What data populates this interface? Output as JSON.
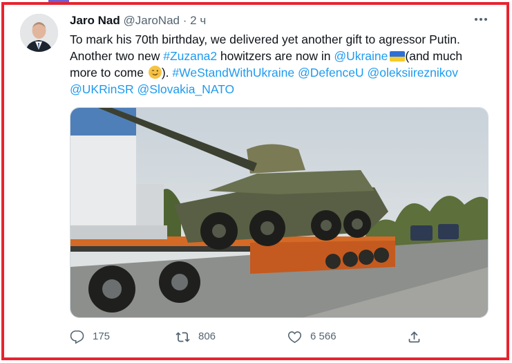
{
  "tweet": {
    "author_name": "Jaro Nad",
    "handle": "@JaroNad",
    "separator": "·",
    "time": "2 ч",
    "text_1": "To mark his 70th birthday, we delivered yet another gift to agressor Putin. Another two new ",
    "hashtag_zuzana": "#Zuzana2",
    "text_2": " howitzers are now in ",
    "mention_ukraine": "@Ukraine",
    "text_3": "(and much more to come ",
    "text_4": "). ",
    "hashtag_standwith": "#WeStandWithUkraine",
    "mention_defence": "@DefenceU",
    "mention_reznikov": "@oleksiireznikov",
    "mention_ukrinsr": "@UKRinSR",
    "mention_nato": "@Slovakia_NATO",
    "flag_emoji": "ukraine-flag",
    "wink_emoji": "winking-face"
  },
  "actions": {
    "replies": "175",
    "retweets": "806",
    "likes": "6 566"
  },
  "icons": {
    "more": "more-icon",
    "reply": "reply-icon",
    "retweet": "retweet-icon",
    "like": "heart-icon",
    "share": "share-icon"
  },
  "colors": {
    "accent": "#1d9bf0",
    "frame": "#e8232f",
    "muted": "#536471",
    "text": "#0f1419"
  }
}
